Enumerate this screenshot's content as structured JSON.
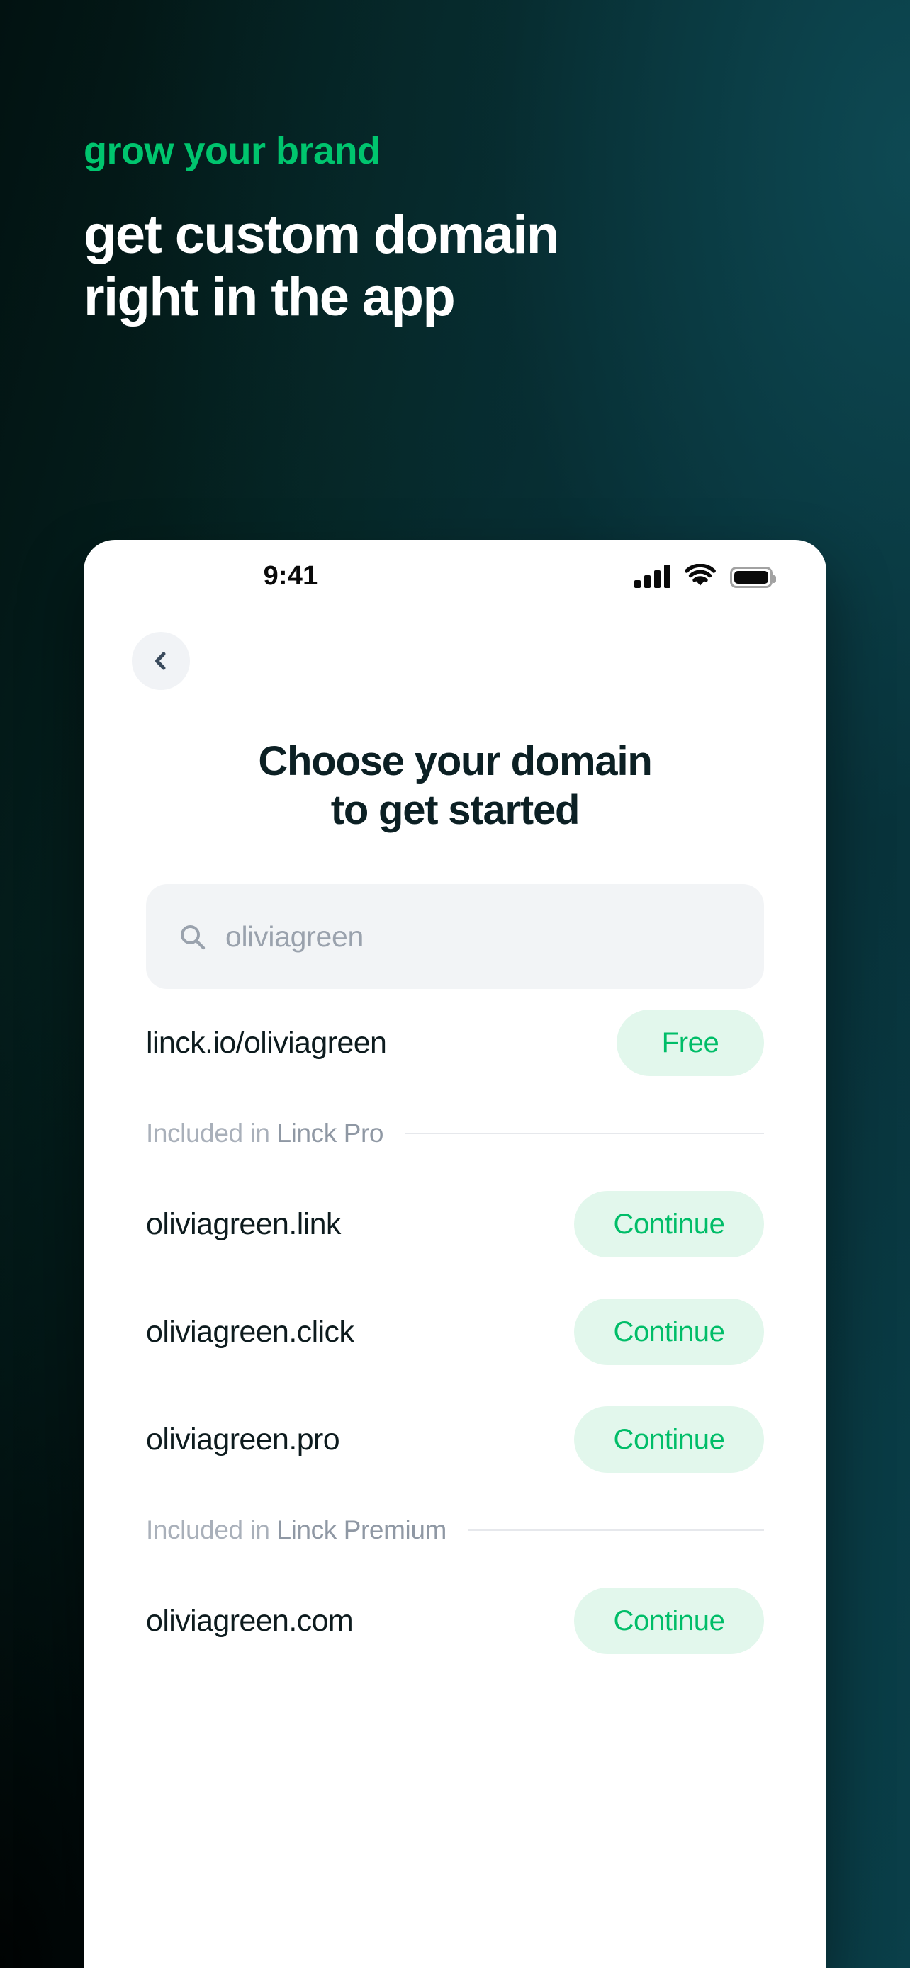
{
  "hero": {
    "eyebrow": "grow your brand",
    "headline_line1": "get custom domain",
    "headline_line2": "right in the app",
    "accent_color": "#00c56e",
    "headline_color": "#ffffff"
  },
  "phone": {
    "status_bar": {
      "time": "9:41",
      "cellular_icon": "cellular-bars-icon",
      "wifi_icon": "wifi-icon",
      "battery_icon": "battery-full-icon"
    },
    "nav": {
      "back_icon": "chevron-left-icon"
    },
    "title_line1": "Choose your domain",
    "title_line2": "to get started",
    "search": {
      "icon": "search-icon",
      "value": "oliviagreen",
      "placeholder": "oliviagreen"
    },
    "primary_row": {
      "domain": "linck.io/oliviagreen",
      "action": "Free"
    },
    "sections": [
      {
        "label_prefix": "Included in ",
        "label_plan": "Linck Pro",
        "rows": [
          {
            "domain": "oliviagreen.link",
            "action": "Continue"
          },
          {
            "domain": "oliviagreen.click",
            "action": "Continue"
          },
          {
            "domain": "oliviagreen.pro",
            "action": "Continue"
          }
        ]
      },
      {
        "label_prefix": "Included in ",
        "label_plan": "Linck Premium",
        "rows": [
          {
            "domain": "oliviagreen.com",
            "action": "Continue"
          }
        ]
      }
    ],
    "colors": {
      "pill_bg": "#e2f7ec",
      "pill_text": "#00bd68",
      "search_bg": "#f2f4f6",
      "title": "#0c2024"
    }
  }
}
